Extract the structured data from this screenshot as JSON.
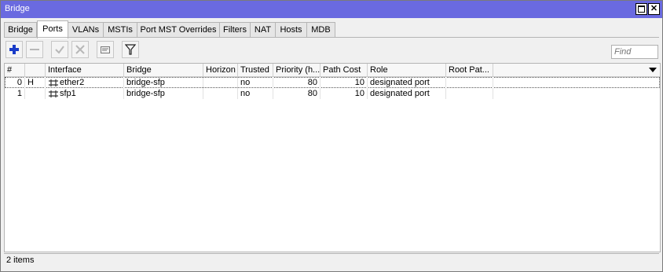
{
  "window": {
    "title": "Bridge"
  },
  "tabs": [
    "Bridge",
    "Ports",
    "VLANs",
    "MSTIs",
    "Port MST Overrides",
    "Filters",
    "NAT",
    "Hosts",
    "MDB"
  ],
  "active_tab": "Ports",
  "toolbar": {
    "icons": [
      "add-icon",
      "remove-icon",
      "enable-icon",
      "disable-icon",
      "comment-icon",
      "filter-icon"
    ]
  },
  "search": {
    "placeholder": "Find"
  },
  "table": {
    "columns": [
      "#",
      "",
      "Interface",
      "Bridge",
      "Horizon",
      "Trusted",
      "Priority (h...",
      "Path Cost",
      "Role",
      "Root Pat..."
    ],
    "rows": [
      {
        "num": "0",
        "flag": "H",
        "interface": "ether2",
        "bridge": "bridge-sfp",
        "horizon": "",
        "trusted": "no",
        "priority": "80",
        "path_cost": "10",
        "role": "designated port",
        "root_path": ""
      },
      {
        "num": "1",
        "flag": "",
        "interface": "sfp1",
        "bridge": "bridge-sfp",
        "horizon": "",
        "trusted": "no",
        "priority": "80",
        "path_cost": "10",
        "role": "designated port",
        "root_path": ""
      }
    ]
  },
  "status": {
    "count": "2 items"
  },
  "colors": {
    "titlebar": "#6a6ae0",
    "add_icon": "#1a3cc8"
  }
}
